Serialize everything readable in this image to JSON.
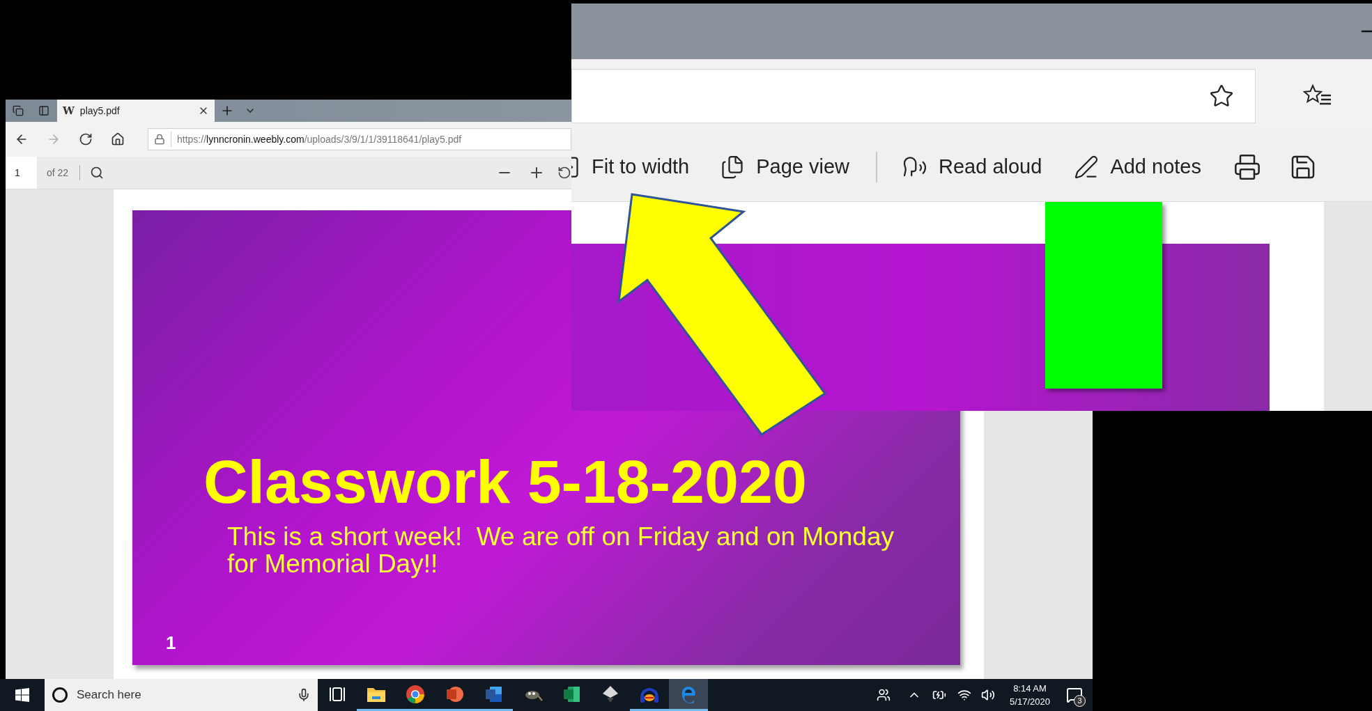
{
  "browser": {
    "tab": {
      "favicon": "W",
      "title": "play5.pdf",
      "selected": true
    },
    "nav": [
      {
        "kind": "back",
        "disabled": false
      },
      {
        "kind": "forward",
        "disabled": true
      },
      {
        "kind": "refresh",
        "disabled": false
      },
      {
        "kind": "home",
        "disabled": false
      }
    ],
    "address": {
      "scheme": "https://",
      "host": "lynncronin.weebly.com",
      "path": "/uploads/3/9/1/1/39118641/play5.pdf"
    },
    "pdf_toolbar": {
      "page": "1",
      "page_count": "of 22"
    },
    "slide": {
      "title": "Classwork 5-18-2020",
      "subtitle": "This is a short week!  We are off on Friday and on Monday for Memorial Day!!",
      "number": "1"
    }
  },
  "inset": {
    "toolbar": [
      {
        "kind": "fit",
        "label": "Fit to width"
      },
      {
        "kind": "page",
        "label": "Page view"
      },
      {
        "kind": "read",
        "label": "Read aloud"
      },
      {
        "kind": "notes",
        "label": "Add notes"
      }
    ]
  },
  "taskbar": {
    "search_placeholder": "Search here",
    "apps": [
      {
        "kind": "taskview",
        "running": false,
        "selected": false
      },
      {
        "kind": "explorer",
        "running": true,
        "selected": false
      },
      {
        "kind": "chrome",
        "running": true,
        "selected": false
      },
      {
        "kind": "powerpoint",
        "running": true,
        "selected": false
      },
      {
        "kind": "word",
        "running": true,
        "selected": false
      },
      {
        "kind": "gimp",
        "running": false,
        "selected": false
      },
      {
        "kind": "excel",
        "running": false,
        "selected": false
      },
      {
        "kind": "inkscape",
        "running": false,
        "selected": false
      },
      {
        "kind": "audacity",
        "running": true,
        "selected": false
      },
      {
        "kind": "edge",
        "running": true,
        "selected": true
      }
    ],
    "time": "8:14 AM",
    "date": "5/17/2020",
    "notifications": "3"
  }
}
